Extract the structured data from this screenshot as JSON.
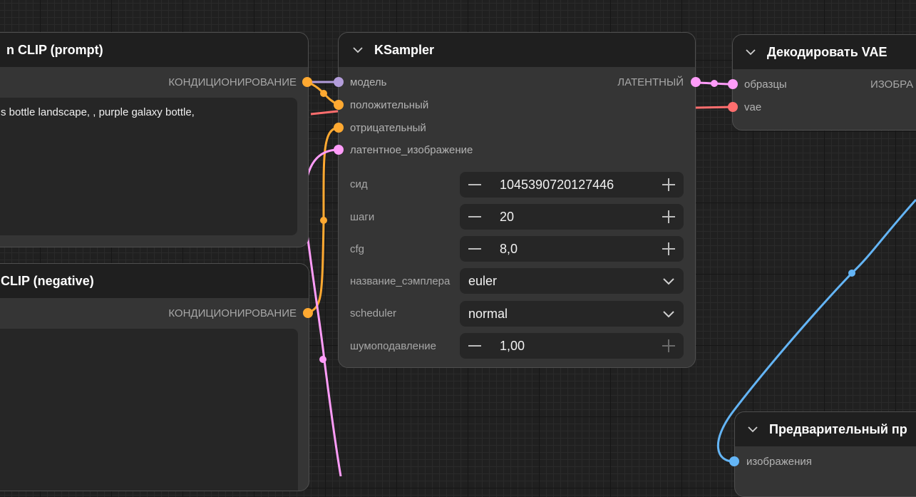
{
  "nodes": {
    "clip_prompt": {
      "title": "n CLIP (prompt)",
      "output_label": "КОНДИЦИОНИРОВАНИЕ",
      "text": "s bottle landscape, , purple galaxy bottle,"
    },
    "clip_negative": {
      "title": " CLIP (negative)",
      "output_label": "КОНДИЦИОНИРОВАНИЕ",
      "text": ""
    },
    "ksampler": {
      "title": "KSampler",
      "inputs": [
        "модель",
        "положительный",
        "отрицательный",
        "латентное_изображение"
      ],
      "output_label": "ЛАТЕНТНЫЙ",
      "widgets": [
        {
          "label": "сид",
          "value": "1045390720127446",
          "kind": "number"
        },
        {
          "label": "шаги",
          "value": "20",
          "kind": "number"
        },
        {
          "label": "cfg",
          "value": "8,0",
          "kind": "number"
        },
        {
          "label": "название_сэмплера",
          "value": "euler",
          "kind": "combo"
        },
        {
          "label": "scheduler",
          "value": "normal",
          "kind": "combo"
        },
        {
          "label": "шумоподавление",
          "value": "1,00",
          "kind": "number"
        }
      ]
    },
    "vae_decode": {
      "title": "Декодировать VAE",
      "inputs": [
        "образцы",
        "vae"
      ],
      "output_label": "ИЗОБРА"
    },
    "preview": {
      "title": "Предварительный пр",
      "inputs": [
        "изображения"
      ]
    }
  },
  "colors": {
    "model": "#b39ddb",
    "conditioning": "#ffa931",
    "latent": "#ff9cf9",
    "vae": "#ff6e6e",
    "image": "#64b5f6",
    "node_bg": "#353535",
    "title_bg": "#1f1f1f",
    "canvas_bg": "#202020"
  },
  "icons": {
    "collapse": "chevron-down-icon",
    "decrement": "minus-icon",
    "increment": "plus-icon",
    "dropdown": "chevron-down-icon"
  }
}
